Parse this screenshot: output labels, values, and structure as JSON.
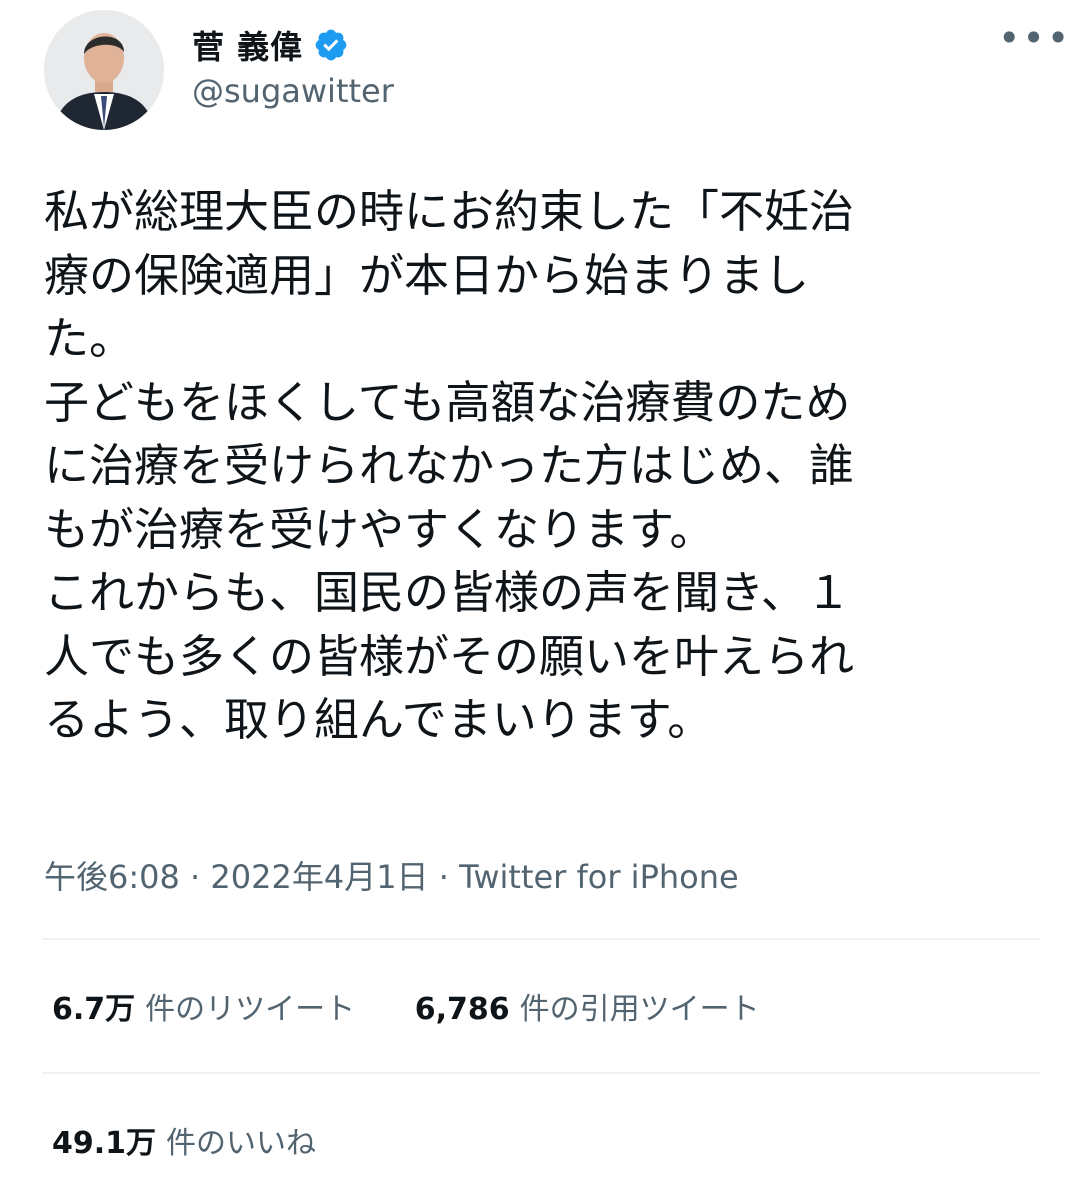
{
  "author": {
    "name": "菅 義偉",
    "handle": "@sugawitter",
    "verified": true,
    "avatar_icon": "person-photo-icon"
  },
  "menu": {
    "more_label": "•••"
  },
  "tweet": {
    "lines": [
      "私が総理大臣の時にお約束した「不妊治",
      "療の保険適用」が本日から始まりまし",
      "た。",
      "子どもをほくしても高額な治療費のため",
      "に治療を受けられなかった方はじめ、誰",
      "もが治療を受けやすくなります。",
      "これからも、国民の皆様の声を聞き、１",
      "人でも多くの皆様がその願いを叶えられ",
      "るよう、取り組んでまいります。"
    ]
  },
  "meta": {
    "time": "午後6:08",
    "date": "2022年4月1日",
    "source": "Twitter for iPhone",
    "separator": " · "
  },
  "stats": {
    "retweets_count": "6.7万",
    "retweets_label": "件のリツイート",
    "quotes_count": "6,786",
    "quotes_label": "件の引用ツイート",
    "likes_count": "49.1万",
    "likes_label": "件のいいね"
  },
  "colors": {
    "text": "#0f1419",
    "secondary": "#536471",
    "divider": "#eff3f4",
    "verified": "#1d9bf0"
  }
}
